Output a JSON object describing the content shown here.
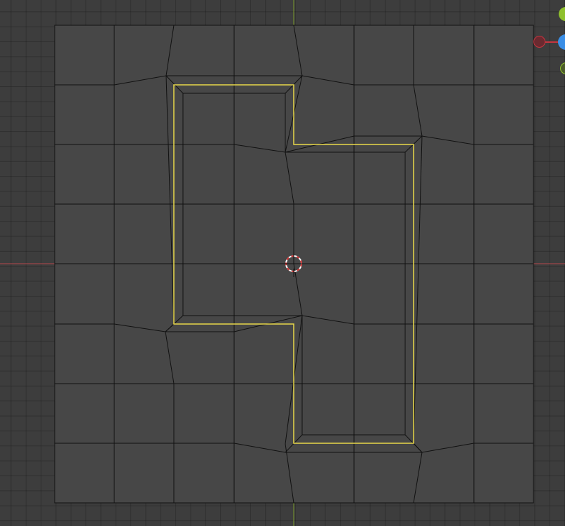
{
  "viewport": {
    "mode": "edit-mode-top-view",
    "colors": {
      "background": "#3d3d3d",
      "plane_fill": "#474747",
      "mesh_edge": "#111111",
      "selection_edge": "#e8d84a",
      "x_axis": "#b5484b",
      "y_axis": "#7c9a2a"
    }
  },
  "gizmo": {
    "icons": [
      "x-axis-negative-icon",
      "z-axis-icon",
      "y-axis-icon",
      "y-axis-negative-icon"
    ],
    "colors": {
      "x": "#c7343f",
      "y": "#8fc02d",
      "z": "#3a8ee6"
    }
  },
  "cursor": {
    "icon": "3d-cursor-icon",
    "colors": [
      "#ffffff",
      "#d43535"
    ]
  }
}
